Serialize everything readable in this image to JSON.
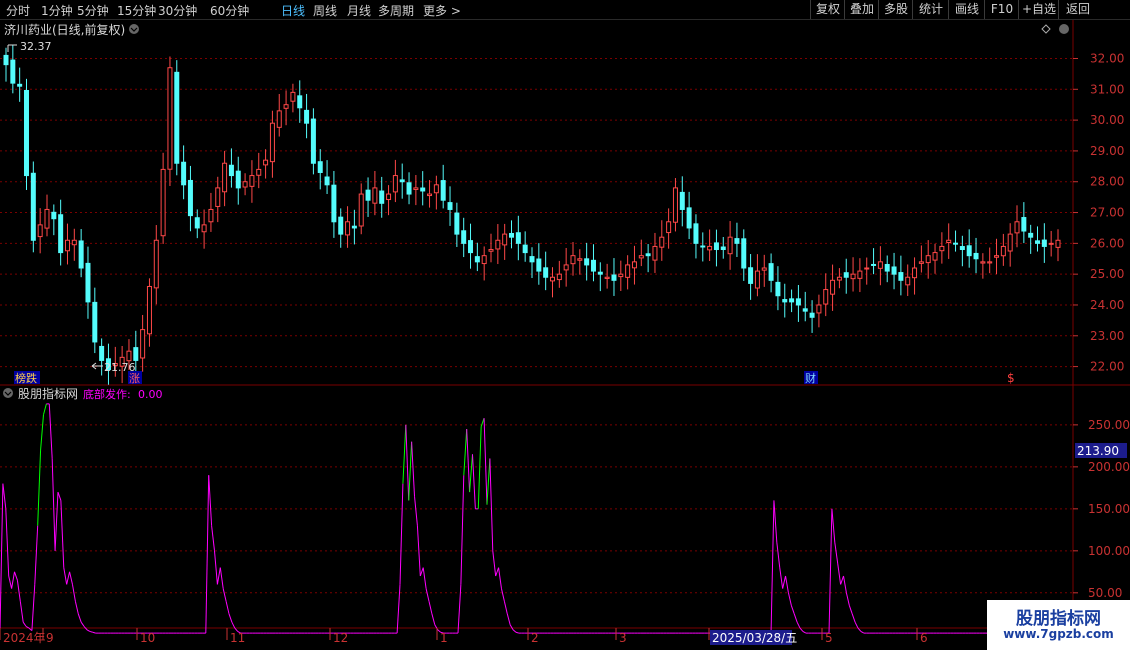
{
  "toolbar": {
    "timeframes": [
      "分时",
      "1分钟",
      "5分钟",
      "15分钟",
      "30分钟",
      "60分钟",
      "日线",
      "周线",
      "月线",
      "多周期",
      "更多 >"
    ],
    "active_timeframe": "日线",
    "right_buttons": [
      "复权",
      "叠加",
      "多股",
      "统计",
      "画线",
      "F10",
      "+自选",
      "返回"
    ]
  },
  "stock_title": "济川药业(日线,前复权)",
  "price_high_label": "32.37",
  "price_low_label": "21.76",
  "badges": {
    "bangdie": "榜跌",
    "zhang": "涨",
    "cai": "财",
    "s": "$"
  },
  "indicator_header": {
    "name": "股朋指标网",
    "series_label": "底部发作:",
    "series_value": "0.00"
  },
  "indicator_current_value": "213.90",
  "date_labels": [
    "2024年",
    "9",
    "10",
    "11",
    "12",
    "1",
    "2",
    "3",
    "2025/03/28/五",
    "5",
    "6"
  ],
  "watermark": {
    "line1": "股朋指标网",
    "line2": "www.7gpzb.com"
  },
  "colors": {
    "up": "#ff4848",
    "down": "#54fcfc",
    "indicator": "#ff00ff",
    "indicator_hi": "#00ff00",
    "grid": "#7a0000",
    "axis_text": "#c83232",
    "badge_bg": "#0000a0"
  },
  "chart_data": [
    {
      "type": "candlestick",
      "ylim": [
        21.5,
        32.6
      ],
      "y_ticks": [
        22.0,
        23.0,
        24.0,
        25.0,
        26.0,
        27.0,
        28.0,
        29.0,
        30.0,
        31.0,
        32.0
      ],
      "y_tick_labels": [
        "22.00",
        "23.00",
        "24.00",
        "25.00",
        "26.00",
        "27.00",
        "28.00",
        "29.00",
        "30.00",
        "31.00",
        "32.00"
      ],
      "series": [
        {
          "values": [
            31.8,
            31.2,
            31.1,
            28.2,
            26.1,
            26.6,
            27.1,
            26.8,
            25.7,
            26.1,
            26.1,
            25.2,
            24.1,
            22.8,
            22.2,
            21.9,
            22.1,
            22.3,
            22.5,
            22.2,
            23.2,
            24.6,
            26.1,
            28.4,
            31.7,
            28.6,
            27.9,
            26.9,
            26.5,
            26.6,
            27.1,
            27.8,
            28.6,
            28.2,
            27.8,
            28.0,
            28.2,
            28.4,
            28.7,
            29.9,
            30.3,
            30.5,
            30.9,
            30.4,
            29.9,
            28.6,
            28.3,
            27.9,
            26.7,
            26.3,
            26.7,
            26.5,
            27.6,
            27.4,
            27.8,
            27.3,
            27.6,
            28.2,
            28.0,
            27.6,
            27.8,
            27.7,
            27.6,
            27.9,
            27.4,
            27.1,
            26.3,
            26.0,
            25.7,
            25.4,
            25.6,
            25.8,
            26.1,
            26.3,
            26.2,
            26.0,
            25.7,
            25.4,
            25.1,
            24.9,
            24.9,
            25.0,
            25.3,
            25.6,
            25.5,
            25.3,
            25.1,
            25.0,
            24.9,
            24.8,
            25.0,
            25.3,
            25.4,
            25.6,
            25.6,
            25.9,
            26.2,
            26.7,
            27.8,
            27.1,
            26.5,
            26.0,
            25.9,
            25.9,
            25.8,
            25.8,
            26.2,
            26.0,
            25.2,
            24.7,
            25.1,
            25.2,
            24.8,
            24.3,
            24.1,
            24.1,
            24.0,
            23.8,
            23.6,
            24.0,
            24.5,
            24.8,
            24.9,
            24.9,
            25.0,
            25.1,
            25.2,
            25.3,
            25.4,
            25.1,
            25.0,
            24.8,
            24.9,
            25.2,
            25.4,
            25.6,
            25.7,
            25.9,
            26.1,
            26.0,
            25.8,
            25.6,
            25.5,
            25.4,
            25.4,
            25.6,
            25.9,
            26.3,
            26.7,
            26.4,
            26.2,
            26.0,
            25.9,
            26.0,
            26.1
          ]
        }
      ]
    },
    {
      "type": "line",
      "title": "底部发作",
      "ylim": [
        20,
        282
      ],
      "y_ticks": [
        50,
        100,
        150,
        200,
        250
      ],
      "y_tick_labels": [
        "50.00",
        "100.00",
        "150.00",
        "200.00",
        "250.00"
      ],
      "series": [
        {
          "name": "底部发作",
          "values": [
            5,
            180,
            150,
            70,
            55,
            75,
            65,
            40,
            15,
            10,
            8,
            5,
            60,
            130,
            220,
            262,
            275,
            275,
            210,
            100,
            170,
            160,
            80,
            60,
            75,
            60,
            40,
            25,
            15,
            10,
            6,
            4,
            3,
            2,
            2,
            2,
            2,
            2,
            2,
            2,
            2,
            2,
            2,
            2,
            2,
            2,
            2,
            2,
            2,
            2,
            2,
            2,
            2,
            2,
            2,
            2,
            2,
            2,
            2,
            2,
            2,
            2,
            2,
            2,
            2,
            2,
            2,
            2,
            2,
            2,
            2,
            2,
            190,
            130,
            100,
            60,
            80,
            55,
            40,
            25,
            15,
            8,
            4,
            2,
            2,
            2,
            2,
            2,
            2,
            2,
            2,
            2,
            2,
            2,
            2,
            2,
            2,
            2,
            2,
            2,
            2,
            2,
            2,
            2,
            2,
            2,
            2,
            2,
            2,
            2,
            2,
            2,
            2,
            2,
            2,
            2,
            2,
            2,
            2,
            2,
            2,
            2,
            2,
            2,
            2,
            2,
            2,
            2,
            2,
            2,
            2,
            2,
            2,
            2,
            2,
            2,
            2,
            2,
            60,
            180,
            250,
            160,
            230,
            165,
            130,
            70,
            80,
            55,
            40,
            25,
            12,
            6,
            3,
            2,
            2,
            2,
            2,
            2,
            2,
            60,
            190,
            245,
            170,
            215,
            150,
            150,
            248,
            258,
            155,
            210,
            100,
            70,
            80,
            55,
            40,
            25,
            12,
            6,
            3,
            2,
            2,
            2,
            2,
            2,
            2,
            2,
            2,
            2,
            2,
            2,
            2,
            2,
            2,
            2,
            2,
            2,
            2,
            2,
            2,
            2,
            2,
            2,
            2,
            2,
            2,
            2,
            2,
            2,
            2,
            2,
            2,
            2,
            2,
            2,
            2,
            2,
            2,
            2,
            2,
            2,
            2,
            2,
            2,
            2,
            2,
            2,
            2,
            2,
            2,
            2,
            2,
            2,
            2,
            2,
            2,
            2,
            2,
            2,
            2,
            2,
            2,
            2,
            2,
            2,
            2,
            2,
            2,
            2,
            2,
            2,
            2,
            2,
            2,
            2,
            2,
            2,
            2,
            2,
            2,
            2,
            2,
            2,
            2,
            2,
            2,
            2,
            2,
            160,
            110,
            80,
            55,
            70,
            50,
            35,
            25,
            15,
            8,
            4,
            2,
            2,
            2,
            2,
            2,
            2,
            2,
            2,
            2,
            150,
            110,
            85,
            60,
            70,
            50,
            35,
            25,
            15,
            8,
            4,
            2,
            2,
            2,
            2,
            2,
            2,
            2,
            2,
            2,
            2,
            2,
            2,
            2,
            2,
            2,
            2,
            2,
            2,
            2,
            2,
            2,
            2,
            2,
            2,
            2,
            2,
            2,
            2,
            2,
            2,
            2,
            2,
            2,
            2,
            2,
            2,
            2,
            2,
            2,
            2,
            2,
            2,
            2,
            2,
            2,
            2,
            2,
            2,
            2,
            2,
            2,
            2,
            2,
            2,
            2,
            2,
            2,
            2,
            2,
            2,
            2,
            2,
            2,
            2,
            2,
            2,
            2,
            2
          ]
        }
      ]
    }
  ]
}
